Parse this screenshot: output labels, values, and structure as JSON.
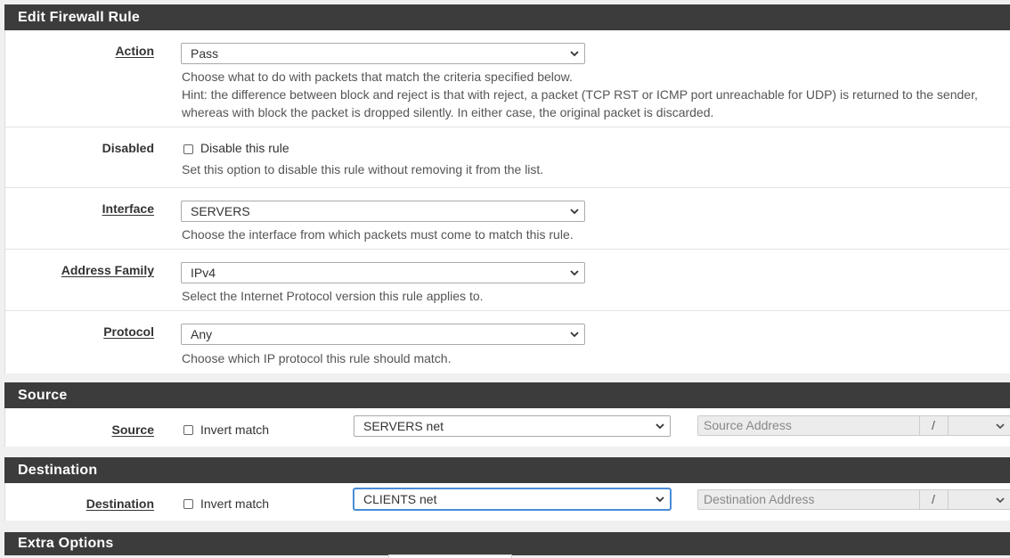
{
  "edit_rule": {
    "title": "Edit Firewall Rule",
    "action": {
      "label": "Action",
      "value": "Pass",
      "help1": "Choose what to do with packets that match the criteria specified below.",
      "help2": "Hint: the difference between block and reject is that with reject, a packet (TCP RST or ICMP port unreachable for UDP) is returned to the sender,",
      "help3": "whereas with block the packet is dropped silently. In either case, the original packet is discarded."
    },
    "disabled": {
      "label": "Disabled",
      "checkbox_label": "Disable this rule",
      "help": "Set this option to disable this rule without removing it from the list."
    },
    "interface": {
      "label": "Interface",
      "value": "SERVERS",
      "help": "Choose the interface from which packets must come to match this rule."
    },
    "address_family": {
      "label": "Address Family",
      "value": "IPv4",
      "help": "Select the Internet Protocol version this rule applies to."
    },
    "protocol": {
      "label": "Protocol",
      "value": "Any",
      "help": "Choose which IP protocol this rule should match."
    }
  },
  "source": {
    "title": "Source",
    "label": "Source",
    "invert_label": "Invert match",
    "value": "SERVERS net",
    "address_placeholder": "Source Address",
    "slash": "/"
  },
  "destination": {
    "title": "Destination",
    "label": "Destination",
    "invert_label": "Invert match",
    "value": "CLIENTS net",
    "address_placeholder": "Destination Address",
    "slash": "/"
  },
  "extra": {
    "title": "Extra Options"
  },
  "icons": {
    "select_arrow": "chevron-down-icon"
  }
}
